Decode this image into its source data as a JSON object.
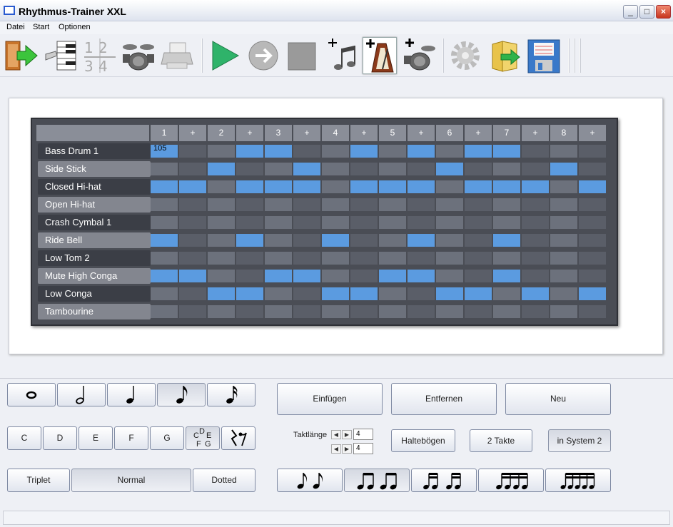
{
  "window": {
    "title": "Rhythmus-Trainer XXL"
  },
  "menu": [
    "Datei",
    "Start",
    "Optionen"
  ],
  "toolbar": {
    "icons": [
      "exit-icon",
      "keyboard-icon",
      "time-signature-icon",
      "drum-kit-icon",
      "printer-icon",
      "play-icon",
      "next-icon",
      "stop-icon",
      "notes-icon",
      "metronome-icon",
      "add-drum-icon",
      "settings-icon",
      "open-folder-icon",
      "save-icon"
    ],
    "active": "metronome-icon"
  },
  "grid": {
    "beats": [
      "1",
      "+",
      "2",
      "+",
      "3",
      "+",
      "4",
      "+",
      "5",
      "+",
      "6",
      "+",
      "7",
      "+",
      "8",
      "+"
    ],
    "tempo_value": "105",
    "instruments": [
      {
        "name": "Bass Drum 1",
        "pattern": [
          1,
          0,
          0,
          1,
          1,
          0,
          0,
          1,
          0,
          1,
          0,
          1,
          1,
          0,
          0,
          0
        ]
      },
      {
        "name": "Side Stick",
        "pattern": [
          0,
          0,
          1,
          0,
          0,
          1,
          0,
          0,
          0,
          0,
          1,
          0,
          0,
          0,
          1,
          0
        ]
      },
      {
        "name": "Closed Hi-hat",
        "pattern": [
          1,
          1,
          0,
          1,
          1,
          1,
          0,
          1,
          1,
          1,
          0,
          1,
          1,
          1,
          0,
          1
        ]
      },
      {
        "name": "Open Hi-hat",
        "pattern": [
          0,
          0,
          0,
          0,
          0,
          0,
          0,
          0,
          0,
          0,
          0,
          0,
          0,
          0,
          0,
          0
        ]
      },
      {
        "name": "Crash Cymbal 1",
        "pattern": [
          0,
          0,
          0,
          0,
          0,
          0,
          0,
          0,
          0,
          0,
          0,
          0,
          0,
          0,
          0,
          0
        ]
      },
      {
        "name": "Ride Bell",
        "pattern": [
          1,
          0,
          0,
          1,
          0,
          0,
          1,
          0,
          0,
          1,
          0,
          0,
          1,
          0,
          0,
          0
        ]
      },
      {
        "name": "Low Tom 2",
        "pattern": [
          0,
          0,
          0,
          0,
          0,
          0,
          0,
          0,
          0,
          0,
          0,
          0,
          0,
          0,
          0,
          0
        ]
      },
      {
        "name": "Mute High Conga",
        "pattern": [
          1,
          1,
          0,
          0,
          1,
          1,
          0,
          0,
          1,
          1,
          0,
          0,
          1,
          0,
          0,
          0
        ]
      },
      {
        "name": "Low Conga",
        "pattern": [
          0,
          0,
          1,
          1,
          0,
          0,
          1,
          1,
          0,
          0,
          1,
          1,
          0,
          1,
          0,
          1
        ]
      },
      {
        "name": "Tambourine",
        "pattern": [
          0,
          0,
          0,
          0,
          0,
          0,
          0,
          0,
          0,
          0,
          0,
          0,
          0,
          0,
          0,
          0
        ]
      }
    ]
  },
  "note_values": [
    "whole-note-icon",
    "half-note-icon",
    "quarter-note-icon",
    "eighth-note-icon",
    "sixteenth-note-icon"
  ],
  "note_value_active": 3,
  "pitches": [
    "C",
    "D",
    "E",
    "F",
    "G"
  ],
  "chord_label": {
    "c": "C",
    "d": "D",
    "e": "E",
    "f": "F",
    "g": "G"
  },
  "rest_icon": "rest-icon",
  "actions": {
    "insert": "Einfügen",
    "remove": "Entfernen",
    "new": "Neu"
  },
  "measure": {
    "label": "Taktlänge",
    "numerator": "4",
    "denominator": "4"
  },
  "ties": "Haltebögen",
  "two_measures": "2 Takte",
  "system": "in System 2",
  "modes": {
    "triplet": "Triplet",
    "normal": "Normal",
    "dotted": "Dotted"
  },
  "groupings": [
    "two-eighths-icon",
    "beamed-eighths-icon",
    "beamed-sixteenths-icon",
    "four-sixteenths-icon",
    "quintuplet-icon"
  ],
  "grouping_active": 1
}
